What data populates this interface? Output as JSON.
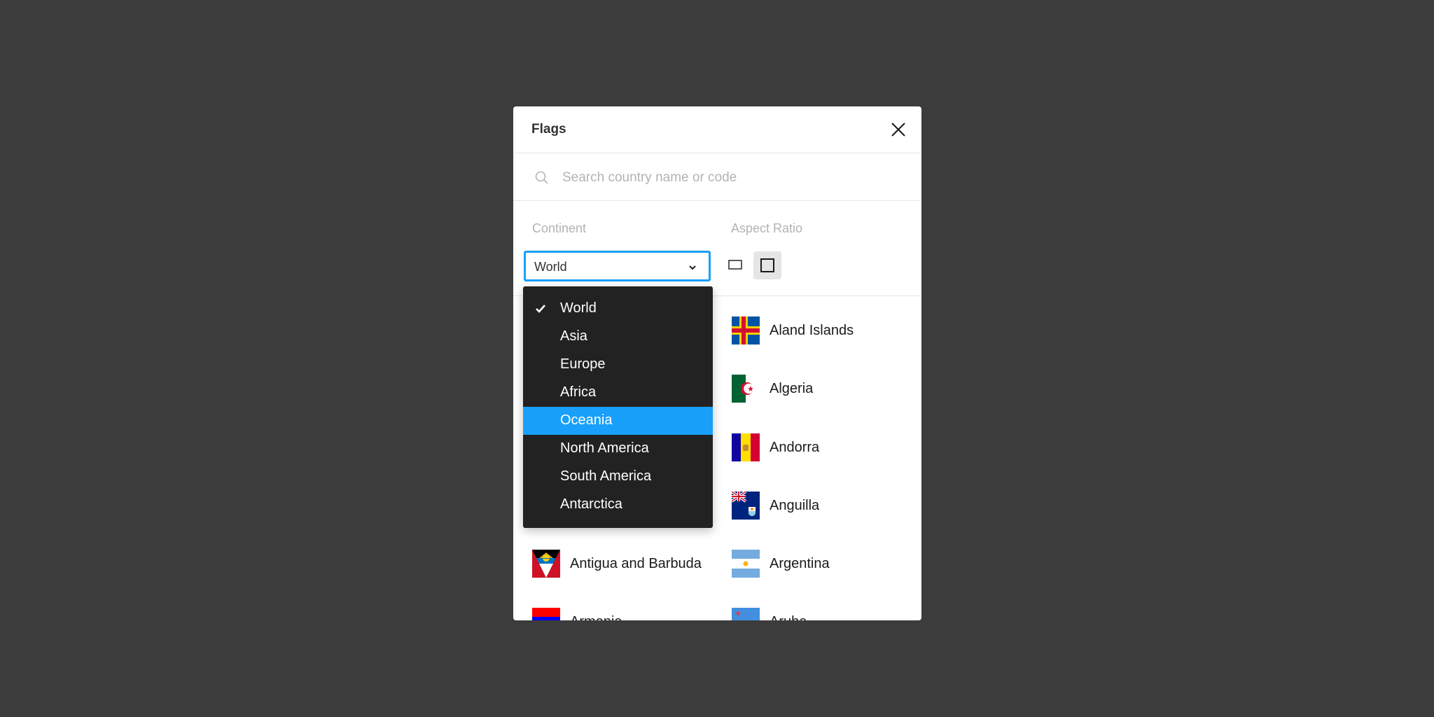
{
  "modal": {
    "title": "Flags",
    "close_icon": "close-icon"
  },
  "search": {
    "placeholder": "Search country name or code",
    "value": "",
    "icon": "search-icon"
  },
  "filters": {
    "continent_label": "Continent",
    "continent_value": "World",
    "aspect_label": "Aspect Ratio",
    "aspect_options": [
      {
        "name": "wide",
        "icon": "rectangle-wide-icon",
        "selected": false
      },
      {
        "name": "square",
        "icon": "square-icon",
        "selected": true
      }
    ]
  },
  "dropdown": {
    "options": [
      {
        "label": "World",
        "checked": true,
        "highlighted": false
      },
      {
        "label": "Asia",
        "checked": false,
        "highlighted": false
      },
      {
        "label": "Europe",
        "checked": false,
        "highlighted": false
      },
      {
        "label": "Africa",
        "checked": false,
        "highlighted": false
      },
      {
        "label": "Oceania",
        "checked": false,
        "highlighted": true
      },
      {
        "label": "North America",
        "checked": false,
        "highlighted": false
      },
      {
        "label": "South America",
        "checked": false,
        "highlighted": false
      },
      {
        "label": "Antarctica",
        "checked": false,
        "highlighted": false
      }
    ]
  },
  "countries": {
    "right_column": [
      "Aland Islands",
      "Algeria",
      "Andorra",
      "Anguilla",
      "Argentina",
      "Aruba"
    ],
    "left_column": [
      "Antigua and Barbuda",
      "Armenia"
    ]
  },
  "colors": {
    "accent": "#18a0fb",
    "dropdown_bg": "#222222",
    "backdrop": "#3c3c3c"
  }
}
